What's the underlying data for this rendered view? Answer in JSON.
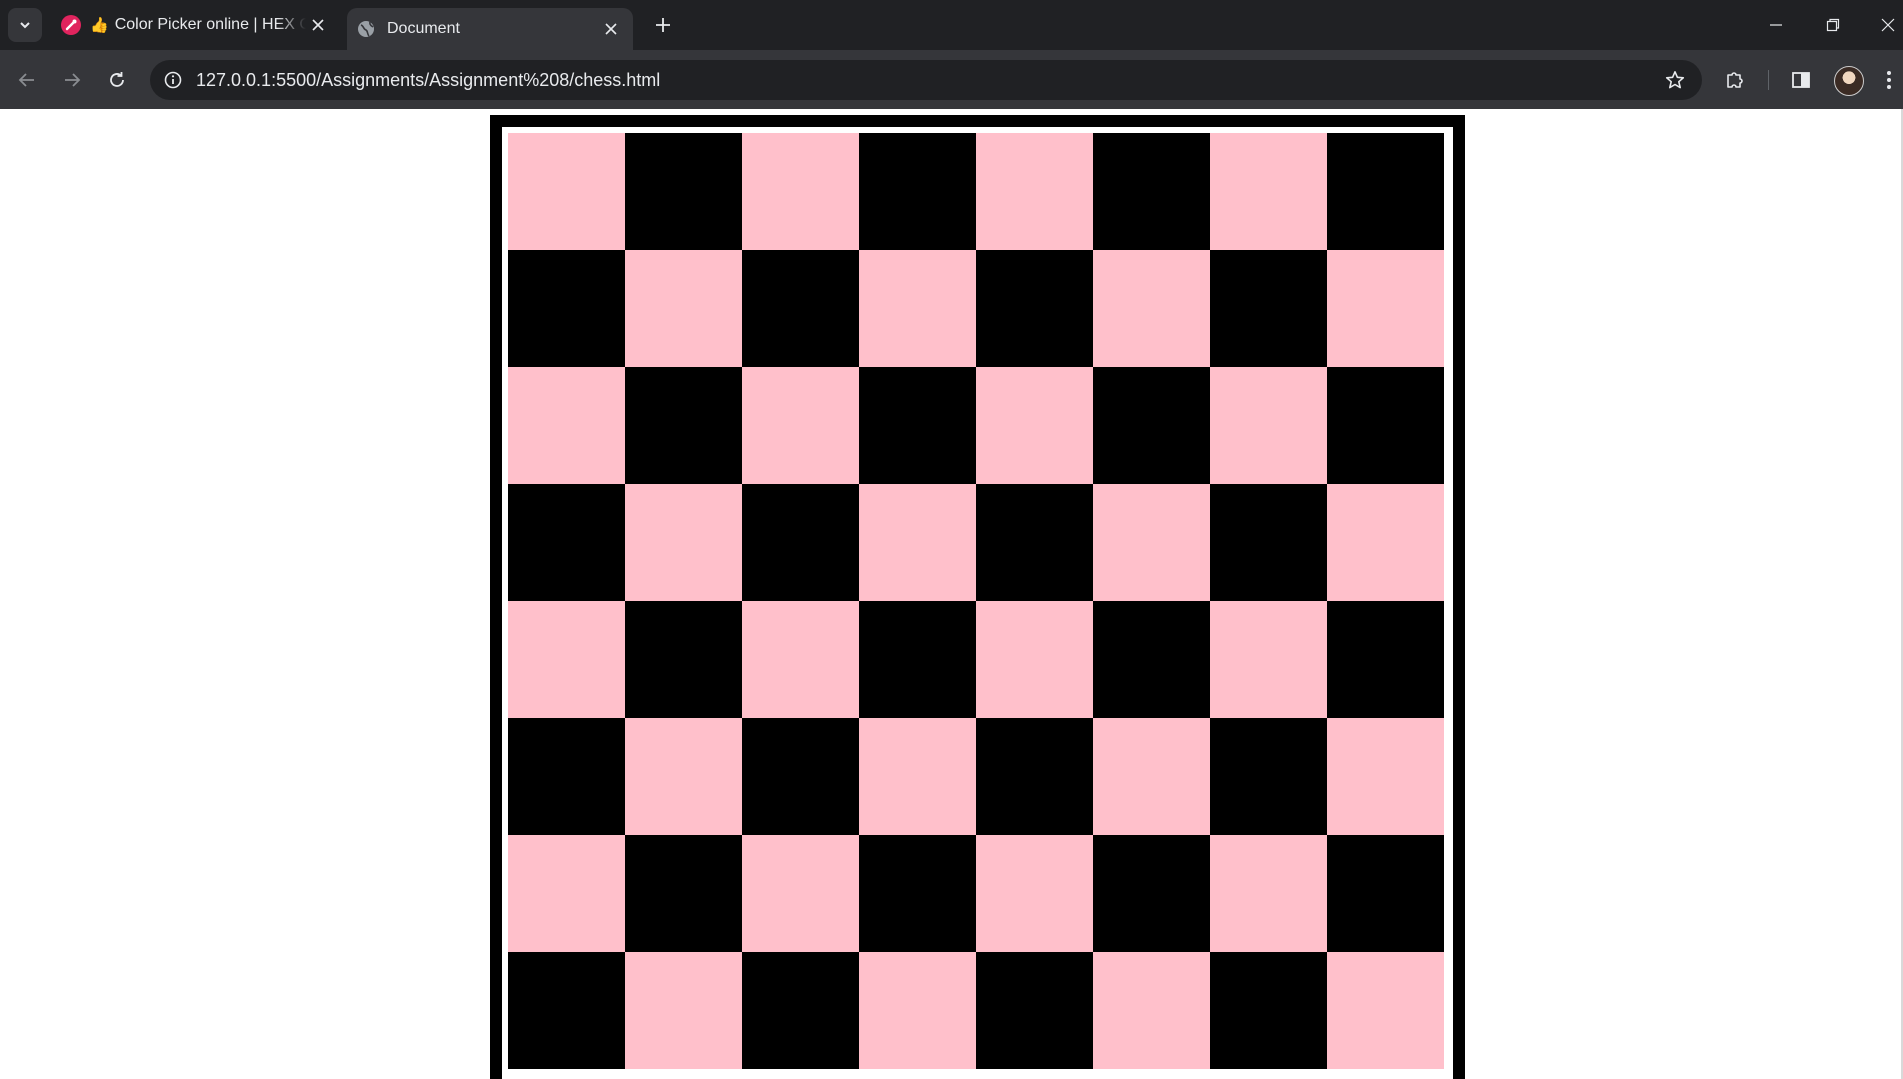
{
  "browser": {
    "tabs": [
      {
        "title": "Color Picker online | HEX Color Picker | HTML Color Picker",
        "favicon": "color-picker-favicon",
        "emoji": "👍",
        "active": false
      },
      {
        "title": "Document",
        "favicon": "globe-icon",
        "active": true
      }
    ],
    "address_bar": {
      "url": "127.0.0.1:5500/Assignments/Assignment%208/chess.html"
    },
    "icons": {
      "tab_search": "chevron-down-icon",
      "new_tab": "plus-icon",
      "minimize": "minimize-icon",
      "restore": "restore-icon",
      "close": "close-icon",
      "back": "back-arrow-icon",
      "forward": "forward-arrow-icon",
      "reload": "reload-icon",
      "site_info": "info-icon",
      "bookmark": "star-icon",
      "extensions": "puzzle-icon",
      "side_panel": "side-panel-icon",
      "profile": "avatar",
      "menu": "kebab-menu-icon"
    }
  },
  "page": {
    "board": {
      "rows": 8,
      "columns": 8,
      "light_color": "#ffc0cb",
      "dark_color": "#000000",
      "frame_color": "#000000",
      "gap_color": "#ffffff",
      "first_square": "light"
    }
  }
}
